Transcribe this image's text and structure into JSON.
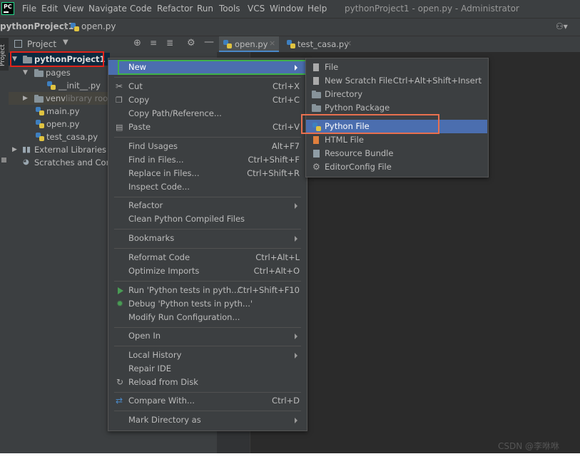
{
  "window": {
    "title": "pythonProject1 - open.py - Administrator",
    "menus": [
      "File",
      "Edit",
      "View",
      "Navigate",
      "Code",
      "Refactor",
      "Run",
      "Tools",
      "VCS",
      "Window",
      "Help"
    ]
  },
  "navbar": {
    "project": "pythonProject1",
    "file": "open.py"
  },
  "toolwindow": {
    "title": "Project",
    "strip_label": "Project"
  },
  "tabs": [
    {
      "label": "open.py"
    },
    {
      "label": "test_casa.py"
    }
  ],
  "tree": {
    "root": "pythonProject1",
    "pages": "pages",
    "init": "__init__.py",
    "venv": "venv",
    "venv_hint": "library root",
    "main": "main.py",
    "open": "open.py",
    "test": "test_casa.py",
    "ext": "External Libraries",
    "scratch": "Scratches and Cons"
  },
  "context_menu": {
    "new": "New",
    "cut": "Cut",
    "cut_sc": "Ctrl+X",
    "copy": "Copy",
    "copy_sc": "Ctrl+C",
    "copy_path": "Copy Path/Reference...",
    "paste": "Paste",
    "paste_sc": "Ctrl+V",
    "find_usages": "Find Usages",
    "find_usages_sc": "Alt+F7",
    "find_files": "Find in Files...",
    "find_files_sc": "Ctrl+Shift+F",
    "replace_files": "Replace in Files...",
    "replace_files_sc": "Ctrl+Shift+R",
    "inspect": "Inspect Code...",
    "refactor": "Refactor",
    "clean": "Clean Python Compiled Files",
    "bookmarks": "Bookmarks",
    "reformat": "Reformat Code",
    "reformat_sc": "Ctrl+Alt+L",
    "optimize": "Optimize Imports",
    "optimize_sc": "Ctrl+Alt+O",
    "run": "Run 'Python tests in pyth...'",
    "run_sc": "Ctrl+Shift+F10",
    "debug": "Debug 'Python tests in pyth...'",
    "modify_run": "Modify Run Configuration...",
    "open_in": "Open In",
    "local_history": "Local History",
    "repair": "Repair IDE",
    "reload": "Reload from Disk",
    "compare": "Compare With...",
    "compare_sc": "Ctrl+D",
    "mark_dir": "Mark Directory as"
  },
  "submenu": {
    "file": "File",
    "scratch": "New Scratch File",
    "scratch_sc": "Ctrl+Alt+Shift+Insert",
    "directory": "Directory",
    "package": "Python Package",
    "python_file": "Python File",
    "html": "HTML File",
    "bundle": "Resource Bundle",
    "editorconfig": "EditorConfig File"
  },
  "watermark": "CSDN @李咻咻",
  "colors": {
    "selection": "#4b6eaf",
    "red_highlight": "#e2231a",
    "green_highlight": "#3fb24a",
    "orange_highlight": "#e8704f"
  }
}
